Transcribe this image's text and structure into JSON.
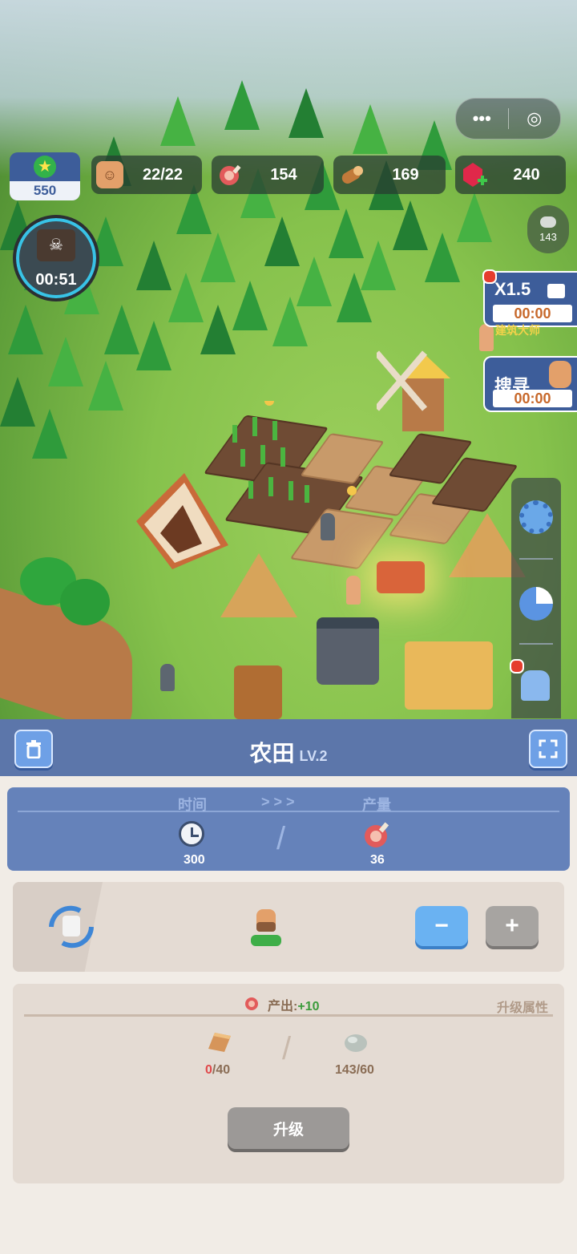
{
  "hud": {
    "level": "550",
    "population": "22/22",
    "meat": "154",
    "wood": "169",
    "gems": "240",
    "stone_small": "143",
    "ship_timer": "00:51",
    "capsule_more": "•••",
    "capsule_target": "◎"
  },
  "side_buttons": {
    "speed_label": "X1.5",
    "speed_timer": "00:00",
    "search_label": "搜寻",
    "search_timer": "00:00",
    "banner_text": "建筑大师"
  },
  "panel": {
    "title": "农田",
    "level": "LV.2",
    "time_label": "时间",
    "arrows": "> > >",
    "output_label": "产量",
    "time_value": "300",
    "output_value": "36",
    "slash": "/",
    "minus_label": "−",
    "plus_label": "+",
    "production_prefix": "产出:",
    "production_value": "+10",
    "upgrade_attr_label": "升级属性",
    "wood_have": "0",
    "wood_need": "/40",
    "stone_req": "143/60",
    "upgrade_button": "升级"
  },
  "colors": {
    "panel_header": "#5c76aa",
    "accent_blue": "#6ea0e6",
    "production_green": "#3b9b3b",
    "insufficient_red": "#e0484a"
  }
}
